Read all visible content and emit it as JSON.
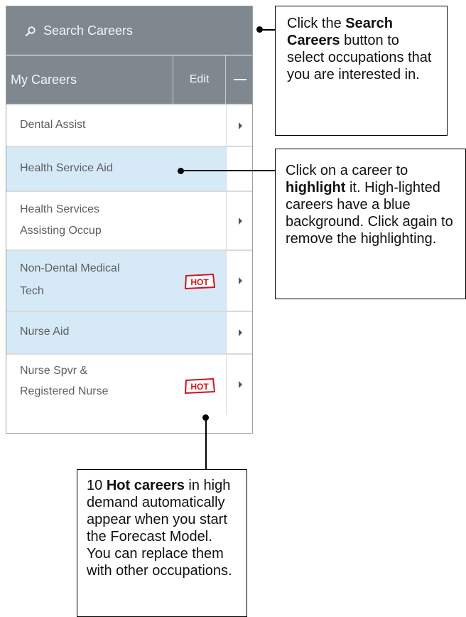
{
  "panel": {
    "search_label": "Search Careers",
    "my_careers_label": "My Careers",
    "edit_label": "Edit",
    "careers": [
      {
        "lines": [
          "Dental Assist"
        ],
        "highlighted": false,
        "hot": false,
        "has_arrow": true
      },
      {
        "lines": [
          "Health Service Aid"
        ],
        "highlighted": true,
        "hot": false,
        "has_arrow": false
      },
      {
        "lines": [
          "Health Services",
          "Assisting Occup"
        ],
        "highlighted": false,
        "hot": false,
        "has_arrow": true
      },
      {
        "lines": [
          "Non-Dental Medical",
          "Tech"
        ],
        "highlighted": true,
        "hot": true,
        "has_arrow": true
      },
      {
        "lines": [
          "Nurse Aid"
        ],
        "highlighted": true,
        "hot": false,
        "has_arrow": true
      },
      {
        "lines": [
          "Nurse Spvr &",
          "Registered Nurse"
        ],
        "highlighted": false,
        "hot": true,
        "has_arrow": true
      }
    ],
    "hot_badge": "HOT",
    "colors": {
      "bar": "#7f878f",
      "highlight": "#d6e9f6",
      "hot_red": "#d2141e"
    }
  },
  "callouts": {
    "search": {
      "p1": "Click the ",
      "b1": "Search",
      "p2": " ",
      "b2": "Careers",
      "p3": " button to select occupations that you are interested in."
    },
    "highlight": {
      "p1": "Click on a career to ",
      "b1": "highlight",
      "p2": " it.  High-lighted careers have a blue background. Click again to remove the highlighting."
    },
    "hot": {
      "p1": "10 ",
      "b1": "Hot careers",
      "p2": " in high demand automatically appear when you start the Forecast Model. You can replace them with other occupations."
    }
  }
}
